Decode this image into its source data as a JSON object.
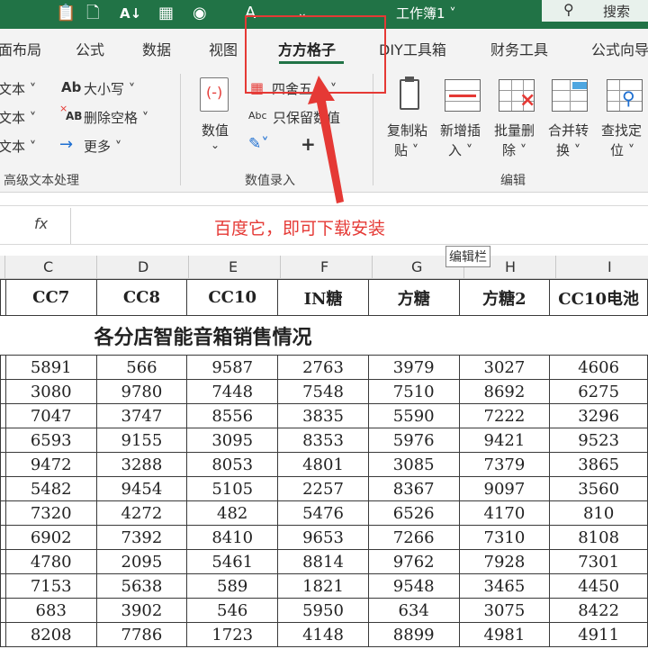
{
  "titlebar": {
    "workbook_name": "工作簿1 ˅",
    "search_label": "搜索",
    "qa_icons": [
      "clipboard-icon",
      "new-file-icon",
      "sort-icon",
      "table-icon",
      "camera-icon",
      "font-icon",
      "more-icon"
    ]
  },
  "tabs": [
    "面布局",
    "公式",
    "数据",
    "视图",
    "方方格子",
    "DIY工具箱",
    "财务工具",
    "公式向导"
  ],
  "active_tab": "方方格子",
  "ribbon": {
    "text_group": {
      "left_items": [
        "文本 ˅",
        "文本 ˅",
        "文本 ˅"
      ],
      "case_label": "大小写 ˅",
      "case_prefix": "Ab",
      "delete_space_label": "删除空格 ˅",
      "delete_prefix": "AB",
      "more_label": "更多 ˅",
      "group_label": "高级文本处理"
    },
    "value_group": {
      "numeric_label": "数值",
      "round_label": "四舍五入 ˅",
      "keep_value_label": "只保留数值",
      "keep_prefix": "Abc",
      "plus_label": "+",
      "group_label": "数值录入"
    },
    "edit_group": {
      "buttons": [
        {
          "l1": "复制粘",
          "l2": "贴 ˅"
        },
        {
          "l1": "新增插",
          "l2": "入 ˅"
        },
        {
          "l1": "批量删",
          "l2": "除 ˅"
        },
        {
          "l1": "合并转",
          "l2": "换 ˅"
        },
        {
          "l1": "查找定",
          "l2": "位 ˅"
        }
      ],
      "group_label": "编辑"
    }
  },
  "formula_bar": {
    "fx": "fx",
    "text": "百度它，即可下载安装"
  },
  "tooltip": "编辑栏",
  "columns": [
    "C",
    "D",
    "E",
    "F",
    "G",
    "H",
    "I"
  ],
  "sheet": {
    "title": "各分店智能音箱销售情况",
    "headers": [
      "CC7",
      "CC8",
      "CC10",
      "IN糖",
      "方糖",
      "方糖2",
      "CC10电池"
    ],
    "rows": [
      [
        "5891",
        "566",
        "9587",
        "2763",
        "3979",
        "3027",
        "4606"
      ],
      [
        "3080",
        "9780",
        "7448",
        "7548",
        "7510",
        "8692",
        "6275"
      ],
      [
        "7047",
        "3747",
        "8556",
        "3835",
        "5590",
        "7222",
        "3296"
      ],
      [
        "6593",
        "9155",
        "3095",
        "8353",
        "5976",
        "9421",
        "9523"
      ],
      [
        "9472",
        "3288",
        "8053",
        "4801",
        "3085",
        "7379",
        "3865"
      ],
      [
        "5482",
        "9454",
        "5105",
        "2257",
        "8367",
        "9097",
        "3560"
      ],
      [
        "7320",
        "4272",
        "482",
        "5476",
        "6526",
        "4170",
        "810"
      ],
      [
        "6902",
        "7392",
        "8410",
        "9653",
        "7266",
        "7310",
        "8108"
      ],
      [
        "4780",
        "2095",
        "5461",
        "8814",
        "9762",
        "7928",
        "7301"
      ],
      [
        "7153",
        "5638",
        "589",
        "1821",
        "9548",
        "3465",
        "4450"
      ],
      [
        "683",
        "3902",
        "546",
        "5950",
        "634",
        "3075",
        "8422"
      ],
      [
        "8208",
        "7786",
        "1723",
        "4148",
        "8899",
        "4981",
        "4911"
      ]
    ]
  },
  "colors": {
    "brand": "#217346",
    "highlight": "#e53935"
  }
}
